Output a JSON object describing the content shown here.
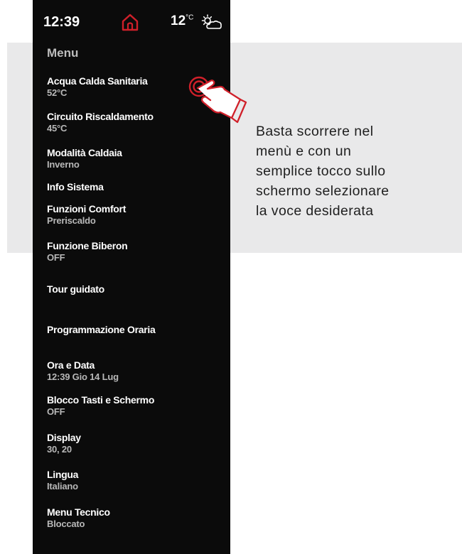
{
  "status_bar": {
    "time": "12:39",
    "temperature": "12",
    "temperature_unit": "°C",
    "home_icon": "home-icon",
    "weather_icon": "partly-sunny-icon",
    "accent_color": "#d0202a"
  },
  "menu": {
    "title": "Menu",
    "items": [
      {
        "label": "Acqua Calda Sanitaria",
        "value": "52°C"
      },
      {
        "label": "Circuito Riscaldamento",
        "value": "45°C"
      },
      {
        "label": "Modalità Caldaia",
        "value": "Inverno"
      },
      {
        "label": "Info Sistema",
        "value": ""
      },
      {
        "label": "Funzioni Comfort",
        "value": "Preriscaldo"
      },
      {
        "label": "Funzione Biberon",
        "value": "OFF"
      },
      {
        "label": "Tour guidato",
        "value": ""
      },
      {
        "label": "Programmazione Oraria",
        "value": ""
      },
      {
        "label": "Ora e Data",
        "value": "12:39 Gio 14 Lug"
      },
      {
        "label": "Blocco Tasti e Schermo",
        "value": "OFF"
      },
      {
        "label": "Display",
        "value": "30, 20"
      },
      {
        "label": "Lingua",
        "value": "Italiano"
      },
      {
        "label": "Menu Tecnico",
        "value": "Bloccato"
      }
    ]
  },
  "callout": {
    "lines": [
      "Basta scorrere nel",
      "menù e con un",
      "semplice tocco sullo",
      "schermo selezionare",
      "la voce desiderata"
    ]
  },
  "gesture_icon": "tap-hand-icon"
}
